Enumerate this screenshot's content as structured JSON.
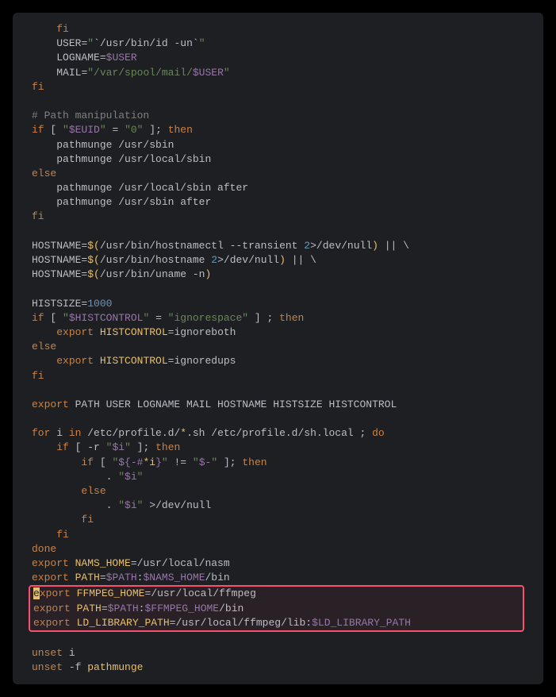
{
  "lines": [
    {
      "indent": "    ",
      "tokens": [
        {
          "t": "fi",
          "c": "keyword"
        }
      ]
    },
    {
      "indent": "    ",
      "tokens": [
        {
          "t": "USER",
          "c": "plain"
        },
        {
          "t": "=",
          "c": "eq"
        },
        {
          "t": "\"",
          "c": "string"
        },
        {
          "t": "`/usr/bin/id -un`",
          "c": "plain"
        },
        {
          "t": "\"",
          "c": "string"
        }
      ]
    },
    {
      "indent": "    ",
      "tokens": [
        {
          "t": "LOGNAME",
          "c": "plain"
        },
        {
          "t": "=",
          "c": "eq"
        },
        {
          "t": "$USER",
          "c": "var"
        }
      ]
    },
    {
      "indent": "    ",
      "tokens": [
        {
          "t": "MAIL",
          "c": "plain"
        },
        {
          "t": "=",
          "c": "eq"
        },
        {
          "t": "\"/var/spool/mail/",
          "c": "string"
        },
        {
          "t": "$USER",
          "c": "var"
        },
        {
          "t": "\"",
          "c": "string"
        }
      ]
    },
    {
      "indent": "",
      "tokens": [
        {
          "t": "fi",
          "c": "keyword"
        }
      ]
    },
    {
      "indent": "",
      "tokens": []
    },
    {
      "indent": "",
      "tokens": [
        {
          "t": "# Path manipulation",
          "c": "comment"
        }
      ]
    },
    {
      "indent": "",
      "tokens": [
        {
          "t": "if",
          "c": "keyword"
        },
        {
          "t": " [ ",
          "c": "plain"
        },
        {
          "t": "\"",
          "c": "string"
        },
        {
          "t": "$EUID",
          "c": "var"
        },
        {
          "t": "\"",
          "c": "string"
        },
        {
          "t": " = ",
          "c": "plain"
        },
        {
          "t": "\"0\"",
          "c": "string"
        },
        {
          "t": " ]; ",
          "c": "plain"
        },
        {
          "t": "then",
          "c": "keyword"
        }
      ]
    },
    {
      "indent": "    ",
      "tokens": [
        {
          "t": "pathmunge /usr/sbin",
          "c": "plain"
        }
      ]
    },
    {
      "indent": "    ",
      "tokens": [
        {
          "t": "pathmunge /usr/local/sbin",
          "c": "plain"
        }
      ]
    },
    {
      "indent": "",
      "tokens": [
        {
          "t": "else",
          "c": "keyword"
        }
      ]
    },
    {
      "indent": "    ",
      "tokens": [
        {
          "t": "pathmunge /usr/local/sbin after",
          "c": "plain"
        }
      ]
    },
    {
      "indent": "    ",
      "tokens": [
        {
          "t": "pathmunge /usr/sbin after",
          "c": "plain"
        }
      ]
    },
    {
      "indent": "",
      "tokens": [
        {
          "t": "fi",
          "c": "keyword"
        }
      ]
    },
    {
      "indent": "",
      "tokens": []
    },
    {
      "indent": "",
      "tokens": [
        {
          "t": "HOSTNAME",
          "c": "plain"
        },
        {
          "t": "=",
          "c": "eq"
        },
        {
          "t": "$(",
          "c": "cmd"
        },
        {
          "t": "/usr/bin/hostnamectl --transient ",
          "c": "plain"
        },
        {
          "t": "2",
          "c": "num"
        },
        {
          "t": ">/dev/null",
          "c": "plain"
        },
        {
          "t": ")",
          "c": "cmd"
        },
        {
          "t": " || \\",
          "c": "plain"
        }
      ]
    },
    {
      "indent": "",
      "tokens": [
        {
          "t": "HOSTNAME",
          "c": "plain"
        },
        {
          "t": "=",
          "c": "eq"
        },
        {
          "t": "$(",
          "c": "cmd"
        },
        {
          "t": "/usr/bin/hostname ",
          "c": "plain"
        },
        {
          "t": "2",
          "c": "num"
        },
        {
          "t": ">/dev/null",
          "c": "plain"
        },
        {
          "t": ")",
          "c": "cmd"
        },
        {
          "t": " || \\",
          "c": "plain"
        }
      ]
    },
    {
      "indent": "",
      "tokens": [
        {
          "t": "HOSTNAME",
          "c": "plain"
        },
        {
          "t": "=",
          "c": "eq"
        },
        {
          "t": "$(",
          "c": "cmd"
        },
        {
          "t": "/usr/bin/uname -n",
          "c": "plain"
        },
        {
          "t": ")",
          "c": "cmd"
        }
      ]
    },
    {
      "indent": "",
      "tokens": []
    },
    {
      "indent": "",
      "tokens": [
        {
          "t": "HISTSIZE",
          "c": "plain"
        },
        {
          "t": "=",
          "c": "eq"
        },
        {
          "t": "1000",
          "c": "num"
        }
      ]
    },
    {
      "indent": "",
      "tokens": [
        {
          "t": "if",
          "c": "keyword"
        },
        {
          "t": " [ ",
          "c": "plain"
        },
        {
          "t": "\"",
          "c": "string"
        },
        {
          "t": "$HISTCONTROL",
          "c": "var"
        },
        {
          "t": "\"",
          "c": "string"
        },
        {
          "t": " = ",
          "c": "plain"
        },
        {
          "t": "\"ignorespace\"",
          "c": "string"
        },
        {
          "t": " ] ; ",
          "c": "plain"
        },
        {
          "t": "then",
          "c": "keyword"
        }
      ]
    },
    {
      "indent": "    ",
      "tokens": [
        {
          "t": "export",
          "c": "keyword"
        },
        {
          "t": " ",
          "c": "plain"
        },
        {
          "t": "HISTCONTROL",
          "c": "cmd"
        },
        {
          "t": "=ignoreboth",
          "c": "plain"
        }
      ]
    },
    {
      "indent": "",
      "tokens": [
        {
          "t": "else",
          "c": "keyword"
        }
      ]
    },
    {
      "indent": "    ",
      "tokens": [
        {
          "t": "export",
          "c": "keyword"
        },
        {
          "t": " ",
          "c": "plain"
        },
        {
          "t": "HISTCONTROL",
          "c": "cmd"
        },
        {
          "t": "=ignoredups",
          "c": "plain"
        }
      ]
    },
    {
      "indent": "",
      "tokens": [
        {
          "t": "fi",
          "c": "keyword"
        }
      ]
    },
    {
      "indent": "",
      "tokens": []
    },
    {
      "indent": "",
      "tokens": [
        {
          "t": "export",
          "c": "keyword"
        },
        {
          "t": " PATH USER LOGNAME MAIL HOSTNAME HISTSIZE HISTCONTROL",
          "c": "plain"
        }
      ]
    },
    {
      "indent": "",
      "tokens": []
    },
    {
      "indent": "",
      "tokens": [
        {
          "t": "for",
          "c": "keyword"
        },
        {
          "t": " i ",
          "c": "plain"
        },
        {
          "t": "in",
          "c": "keyword"
        },
        {
          "t": " /etc/profile.d/",
          "c": "plain"
        },
        {
          "t": "*",
          "c": "cmd"
        },
        {
          "t": ".sh /etc/profile.d/sh.local ; ",
          "c": "plain"
        },
        {
          "t": "do",
          "c": "keyword"
        }
      ]
    },
    {
      "indent": "    ",
      "tokens": [
        {
          "t": "if",
          "c": "keyword"
        },
        {
          "t": " [ -r ",
          "c": "plain"
        },
        {
          "t": "\"",
          "c": "string"
        },
        {
          "t": "$i",
          "c": "var"
        },
        {
          "t": "\"",
          "c": "string"
        },
        {
          "t": " ]; ",
          "c": "plain"
        },
        {
          "t": "then",
          "c": "keyword"
        }
      ]
    },
    {
      "indent": "        ",
      "tokens": [
        {
          "t": "if",
          "c": "keyword"
        },
        {
          "t": " [ ",
          "c": "plain"
        },
        {
          "t": "\"",
          "c": "string"
        },
        {
          "t": "${-#",
          "c": "var"
        },
        {
          "t": "*i",
          "c": "cmd"
        },
        {
          "t": "}",
          "c": "var"
        },
        {
          "t": "\"",
          "c": "string"
        },
        {
          "t": " != ",
          "c": "plain"
        },
        {
          "t": "\"",
          "c": "string"
        },
        {
          "t": "$-",
          "c": "var"
        },
        {
          "t": "\"",
          "c": "string"
        },
        {
          "t": " ]; ",
          "c": "plain"
        },
        {
          "t": "then",
          "c": "keyword"
        }
      ]
    },
    {
      "indent": "            ",
      "tokens": [
        {
          "t": ". ",
          "c": "plain"
        },
        {
          "t": "\"",
          "c": "string"
        },
        {
          "t": "$i",
          "c": "var"
        },
        {
          "t": "\"",
          "c": "string"
        }
      ]
    },
    {
      "indent": "        ",
      "tokens": [
        {
          "t": "else",
          "c": "keyword"
        }
      ]
    },
    {
      "indent": "            ",
      "tokens": [
        {
          "t": ". ",
          "c": "plain"
        },
        {
          "t": "\"",
          "c": "string"
        },
        {
          "t": "$i",
          "c": "var"
        },
        {
          "t": "\"",
          "c": "string"
        },
        {
          "t": " >/dev/null",
          "c": "plain"
        }
      ]
    },
    {
      "indent": "        ",
      "tokens": [
        {
          "t": "fi",
          "c": "keyword"
        }
      ]
    },
    {
      "indent": "    ",
      "tokens": [
        {
          "t": "fi",
          "c": "keyword"
        }
      ]
    },
    {
      "indent": "",
      "tokens": [
        {
          "t": "done",
          "c": "keyword"
        }
      ]
    },
    {
      "indent": "",
      "tokens": [
        {
          "t": "export",
          "c": "keyword"
        },
        {
          "t": " ",
          "c": "plain"
        },
        {
          "t": "NAMS_HOME",
          "c": "cmd"
        },
        {
          "t": "=/usr/local/nasm",
          "c": "plain"
        }
      ]
    },
    {
      "indent": "",
      "tokens": [
        {
          "t": "export",
          "c": "keyword"
        },
        {
          "t": " ",
          "c": "plain"
        },
        {
          "t": "PATH",
          "c": "cmd"
        },
        {
          "t": "=",
          "c": "plain"
        },
        {
          "t": "$PATH",
          "c": "var"
        },
        {
          "t": ":",
          "c": "plain"
        },
        {
          "t": "$NAMS_HOME",
          "c": "var"
        },
        {
          "t": "/bin",
          "c": "plain"
        }
      ]
    }
  ],
  "highlight": [
    {
      "indent": "",
      "tokens": [
        {
          "t": "e",
          "c": "cursor"
        },
        {
          "t": "xport",
          "c": "keyword"
        },
        {
          "t": " ",
          "c": "plain"
        },
        {
          "t": "FFMPEG_HOME",
          "c": "cmd"
        },
        {
          "t": "=/usr/local/ffmpeg",
          "c": "plain"
        }
      ]
    },
    {
      "indent": "",
      "tokens": [
        {
          "t": "export",
          "c": "keyword"
        },
        {
          "t": " ",
          "c": "plain"
        },
        {
          "t": "PATH",
          "c": "cmd"
        },
        {
          "t": "=",
          "c": "plain"
        },
        {
          "t": "$PATH",
          "c": "var"
        },
        {
          "t": ":",
          "c": "plain"
        },
        {
          "t": "$FFMPEG_HOME",
          "c": "var"
        },
        {
          "t": "/bin",
          "c": "plain"
        }
      ]
    },
    {
      "indent": "",
      "tokens": [
        {
          "t": "export",
          "c": "keyword"
        },
        {
          "t": " ",
          "c": "plain"
        },
        {
          "t": "LD_LIBRARY_PATH",
          "c": "cmd"
        },
        {
          "t": "=/usr/local/ffmpeg/lib:",
          "c": "plain"
        },
        {
          "t": "$LD_LIBRARY_PATH",
          "c": "var"
        }
      ]
    }
  ],
  "tail": [
    {
      "indent": "",
      "tokens": []
    },
    {
      "indent": "",
      "tokens": [
        {
          "t": "unset",
          "c": "keyword"
        },
        {
          "t": " i",
          "c": "plain"
        }
      ]
    },
    {
      "indent": "",
      "tokens": [
        {
          "t": "unset",
          "c": "keyword"
        },
        {
          "t": " -f ",
          "c": "plain"
        },
        {
          "t": "pathmunge",
          "c": "cmd"
        }
      ]
    }
  ],
  "colors": {
    "keyword": "#cc8242",
    "string": "#6a8759",
    "var": "#9876aa",
    "cmd": "#e8bf6a",
    "num": "#6897bb",
    "plain": "#bcbec4",
    "comment": "#808080",
    "bg": "#1e1f22",
    "highlight_border": "#f95070"
  }
}
